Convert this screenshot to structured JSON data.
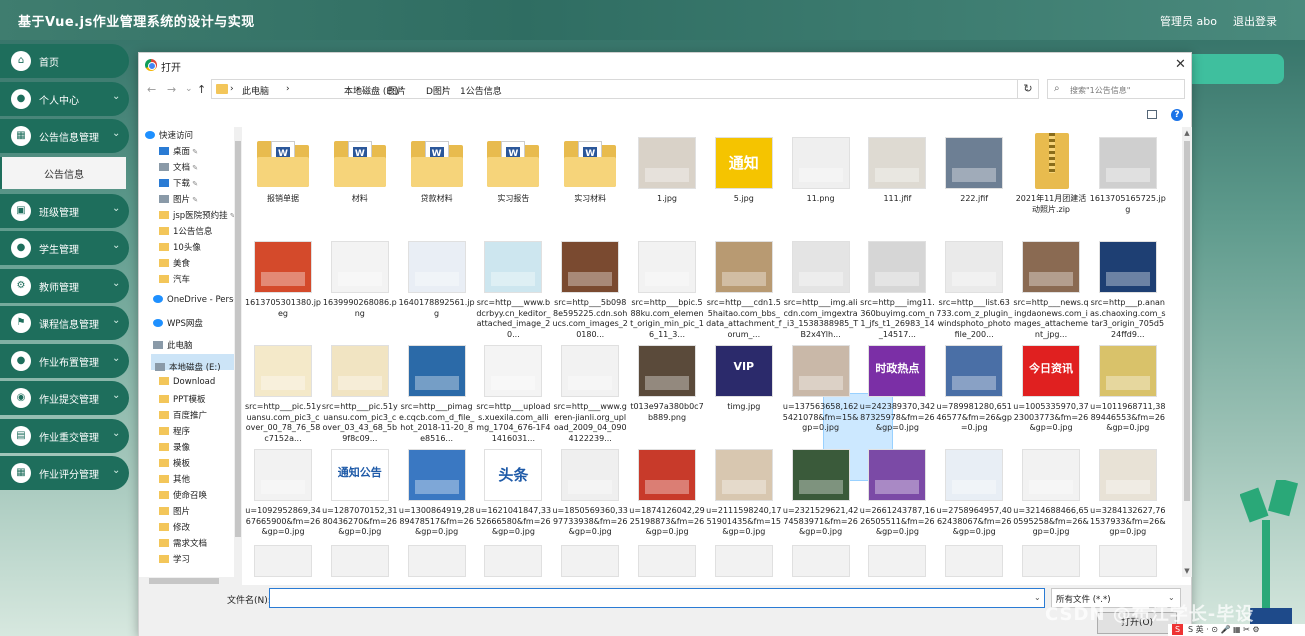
{
  "app": {
    "title": "基于Vue.js作业管理系统的设计与实现",
    "user": "管理员 abo",
    "logout": "退出登录"
  },
  "sidebar": {
    "items": [
      {
        "label": "首页",
        "icon": "home-icon",
        "glyph": "⌂",
        "expandable": false
      },
      {
        "label": "个人中心",
        "icon": "user-icon",
        "glyph": "●",
        "expandable": true
      },
      {
        "label": "公告信息管理",
        "icon": "grid-icon",
        "glyph": "▦",
        "expandable": true
      },
      {
        "label": "班级管理",
        "icon": "book-icon",
        "glyph": "▣",
        "expandable": true
      },
      {
        "label": "学生管理",
        "icon": "student-icon",
        "glyph": "●",
        "expandable": true
      },
      {
        "label": "教师管理",
        "icon": "teacher-icon",
        "glyph": "⚙",
        "expandable": true
      },
      {
        "label": "课程信息管理",
        "icon": "flag-icon",
        "glyph": "⚑",
        "expandable": true
      },
      {
        "label": "作业布置管理",
        "icon": "assign-icon",
        "glyph": "●",
        "expandable": true
      },
      {
        "label": "作业提交管理",
        "icon": "submit-icon",
        "glyph": "◉",
        "expandable": true
      },
      {
        "label": "作业重交管理",
        "icon": "resubmit-icon",
        "glyph": "▤",
        "expandable": true
      },
      {
        "label": "作业评分管理",
        "icon": "score-icon",
        "glyph": "▦",
        "expandable": true
      }
    ],
    "sub_item": "公告信息"
  },
  "dialog": {
    "title": "打开",
    "close": "✕",
    "nav": {
      "back": "←",
      "forward": "→",
      "dropdown": "⌄",
      "up": "↑"
    },
    "breadcrumb": [
      "›",
      "此电脑",
      "›",
      "本地磁盘 (E:)",
      "›",
      "图片",
      "›",
      "D图片",
      "›",
      "1公告信息"
    ],
    "refresh": "↻",
    "search_placeholder": "搜索\"1公告信息\"",
    "help": "?",
    "tree": [
      {
        "label": "快速访问",
        "type": "sky"
      },
      {
        "label": "桌面",
        "type": "blue",
        "pin": true
      },
      {
        "label": "文档",
        "type": "gray",
        "pin": true
      },
      {
        "label": "下载",
        "type": "blue",
        "pin": true
      },
      {
        "label": "图片",
        "type": "gray",
        "pin": true
      },
      {
        "label": "jsp医院预约挂",
        "type": "fold",
        "pin": true
      },
      {
        "label": "1公告信息",
        "type": "fold"
      },
      {
        "label": "10头像",
        "type": "fold"
      },
      {
        "label": "美食",
        "type": "fold"
      },
      {
        "label": "汽车",
        "type": "fold"
      },
      {
        "label": "OneDrive - Perso",
        "type": "sky"
      },
      {
        "label": "WPS网盘",
        "type": "sky"
      },
      {
        "label": "此电脑",
        "type": "gray"
      },
      {
        "label": "本地磁盘 (E:)",
        "type": "gray"
      },
      {
        "label": "Download",
        "type": "fold"
      },
      {
        "label": "PPT模板",
        "type": "fold"
      },
      {
        "label": "百度推广",
        "type": "fold"
      },
      {
        "label": "程序",
        "type": "fold"
      },
      {
        "label": "录像",
        "type": "fold"
      },
      {
        "label": "模板",
        "type": "fold"
      },
      {
        "label": "其他",
        "type": "fold"
      },
      {
        "label": "使命召唤",
        "type": "fold"
      },
      {
        "label": "图片",
        "type": "fold"
      },
      {
        "label": "修改",
        "type": "fold"
      },
      {
        "label": "需求文档",
        "type": "fold"
      },
      {
        "label": "学习",
        "type": "fold"
      }
    ],
    "files": [
      {
        "name": "报销单据",
        "kind": "folder"
      },
      {
        "name": "材料",
        "kind": "folder"
      },
      {
        "name": "贷款材料",
        "kind": "folder"
      },
      {
        "name": "实习报告",
        "kind": "folder"
      },
      {
        "name": "实习材料",
        "kind": "folder"
      },
      {
        "name": "1.jpg",
        "kind": "image",
        "color": "#d9d2c8"
      },
      {
        "name": "5.jpg",
        "kind": "image",
        "color": "#f5c400",
        "text": "通知"
      },
      {
        "name": "11.png",
        "kind": "image",
        "color": "#efefef"
      },
      {
        "name": "111.jfif",
        "kind": "image",
        "color": "#dedad2"
      },
      {
        "name": "222.jfif",
        "kind": "image",
        "color": "#6d7f94"
      },
      {
        "name": "2021年11月团建活动照片.zip",
        "kind": "zip"
      },
      {
        "name": "1613705165725.jpg",
        "kind": "image",
        "color": "#cfcfcf"
      },
      {
        "name": "1613705301380.jpeg",
        "kind": "image",
        "color": "#d44a2b"
      },
      {
        "name": "1639990268086.png",
        "kind": "image",
        "color": "#f3f3f3"
      },
      {
        "name": "1640178892561.jpg",
        "kind": "image",
        "color": "#e9eef5"
      },
      {
        "name": "src=http___www.bdcrbyy.cn_keditor_attached_image_20...",
        "kind": "image",
        "color": "#cde6ef"
      },
      {
        "name": "src=http___5b0988e595225.cdn.sohucs.com_images_20180...",
        "kind": "image",
        "color": "#7a4a30"
      },
      {
        "name": "src=http___bpic.588ku.com_element_origin_min_pic_16_11_3...",
        "kind": "image",
        "color": "#f2f2f2"
      },
      {
        "name": "src=http___cdn1.55haitao.com_bbs_data_attachment_forum_...",
        "kind": "image",
        "color": "#b89a72"
      },
      {
        "name": "src=http___img.alicdn.com_imgextra_i3_1538388985_TB2x4Ylh...",
        "kind": "image",
        "color": "#e4e4e4"
      },
      {
        "name": "src=http___img11.360buyimg.com_n1_jfs_t1_26983_14_14517...",
        "kind": "image",
        "color": "#d6d6d6"
      },
      {
        "name": "src=http___list.63733.com_z_plugin_windsphoto_photofile_200...",
        "kind": "image",
        "color": "#eaeaea"
      },
      {
        "name": "src=http___news.qingdaonews.com_images_attachement_jpg...",
        "kind": "image",
        "color": "#8a6a52"
      },
      {
        "name": "src=http___p.ananas.chaoxing.com_star3_origin_705d524ffd9...",
        "kind": "image",
        "color": "#1e3f73"
      },
      {
        "name": "src=http___pic.51yuansu.com_pic3_cover_00_78_76_58c7152a...",
        "kind": "image",
        "color": "#f4e9c9"
      },
      {
        "name": "src=http___pic.51yuansu.com_pic3_cover_03_43_68_5b9f8c09...",
        "kind": "image",
        "color": "#f1e4c2"
      },
      {
        "name": "src=http___pimage.cqcb.com_d_file_hot_2018-11-20_8e8516...",
        "kind": "image",
        "color": "#2b6aa8"
      },
      {
        "name": "src=http___uploads.xuexila.com_allimg_1704_676-1F41416031...",
        "kind": "image",
        "color": "#f4f4f4"
      },
      {
        "name": "src=http___www.geren-jianli.org_upload_2009_04_0904122239...",
        "kind": "image",
        "color": "#f2f2f2"
      },
      {
        "name": "t013e97a380b0c7b889.png",
        "kind": "image",
        "color": "#5a4a3a"
      },
      {
        "name": "timg.jpg",
        "kind": "image",
        "color": "#2b2a6b",
        "text": "VIP"
      },
      {
        "name": "u=137563658,1625421078&fm=15&gp=0.jpg",
        "kind": "image",
        "color": "#c9b8a8"
      },
      {
        "name": "u=242389370,34287325978&fm=26&gp=0.jpg",
        "kind": "image",
        "color": "#7b2fa6",
        "text": "时政热点"
      },
      {
        "name": "u=789981280,65146577&fm=26&gp=0.jpg",
        "kind": "image",
        "color": "#4a6fa6"
      },
      {
        "name": "u=1005335970,3723003773&fm=26&gp=0.jpg",
        "kind": "image",
        "color": "#e02020",
        "text": "今日资讯"
      },
      {
        "name": "u=1011968711,3889446553&fm=26&gp=0.jpg",
        "kind": "image",
        "color": "#d9c26a"
      },
      {
        "name": "u=1092952869,3467665900&fm=26&gp=0.jpg",
        "kind": "image",
        "color": "#f2f2f2"
      },
      {
        "name": "u=1287070152,3180436270&fm=26&gp=0.jpg",
        "kind": "image",
        "color": "#ffffff",
        "text": "通知公告"
      },
      {
        "name": "u=1300864919,2889478517&fm=26&gp=0.jpg",
        "kind": "image",
        "color": "#3a78c2"
      },
      {
        "name": "u=1621041847,3352666580&fm=26&gp=0.jpg",
        "kind": "image",
        "color": "#ffffff",
        "text": "头条"
      },
      {
        "name": "u=1850569360,3397733938&fm=26&gp=0.jpg",
        "kind": "image",
        "color": "#efefef"
      },
      {
        "name": "u=1874126042,2925198873&fm=26&gp=0.jpg",
        "kind": "image",
        "color": "#c83a2a"
      },
      {
        "name": "u=2111598240,1751901435&fm=15&gp=0.jpg",
        "kind": "image",
        "color": "#d8c7b0"
      },
      {
        "name": "u=2321529621,4274583971&fm=26&gp=0.jpg",
        "kind": "image",
        "color": "#3a5a3a"
      },
      {
        "name": "u=2661243787,1626505511&fm=26&gp=0.jpg",
        "kind": "image",
        "color": "#7b4aa6"
      },
      {
        "name": "u=2758964957,4062438067&fm=26&gp=0.jpg",
        "kind": "image",
        "color": "#e8eef5"
      },
      {
        "name": "u=3214688466,650595258&fm=26&gp=0.jpg",
        "kind": "image",
        "color": "#f2f2f2"
      },
      {
        "name": "u=3284132627,761537933&fm=26&gp=0.jpg",
        "kind": "image",
        "color": "#e8e2d6"
      }
    ],
    "filename_label": "文件名(N):",
    "filename_value": "",
    "filetype": "所有文件 (*.*)",
    "open_button": "打开(O)"
  },
  "watermark": "CSDN @布江学长-毕设",
  "tray": "S 英 · ⊙ 🎤 ▦ ✂ ⚙"
}
